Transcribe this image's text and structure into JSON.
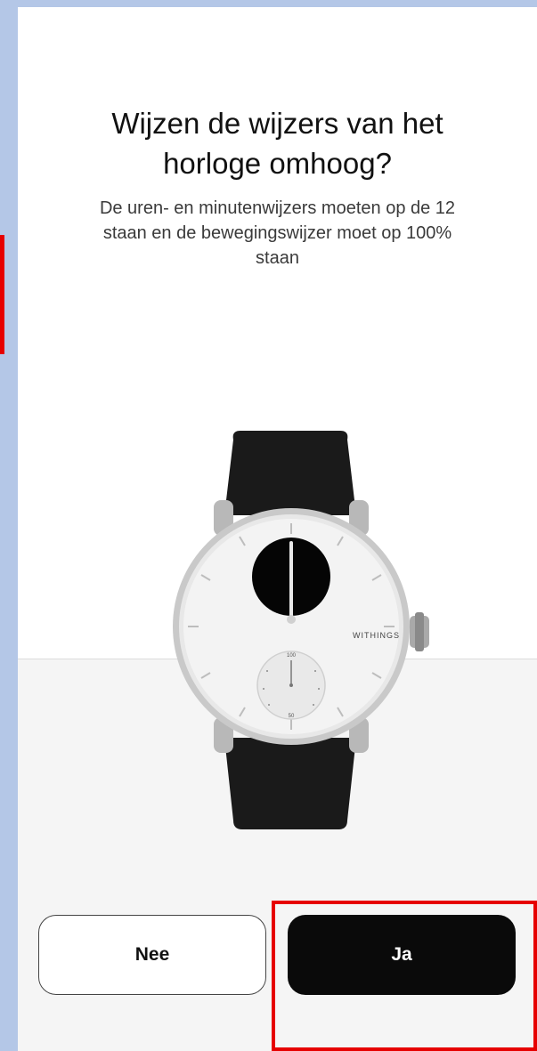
{
  "prompt": {
    "title_line1": "Wijzen de wijzers van het",
    "title_line2": "horloge omhoog?",
    "subtitle_line1": "De uren- en minutenwijzers moeten op de 12",
    "subtitle_line2": "staan en de bewegingswijzer moet op 100%",
    "subtitle_line3": "staan"
  },
  "watch": {
    "brand": "WITHINGS",
    "subdial_top": "100",
    "subdial_bottom": "50"
  },
  "buttons": {
    "no_label": "Nee",
    "yes_label": "Ja"
  },
  "colors": {
    "background": "#b4c7e7",
    "screen": "#ffffff",
    "yes_button": "#0a0a0a",
    "highlight": "#e60000"
  }
}
